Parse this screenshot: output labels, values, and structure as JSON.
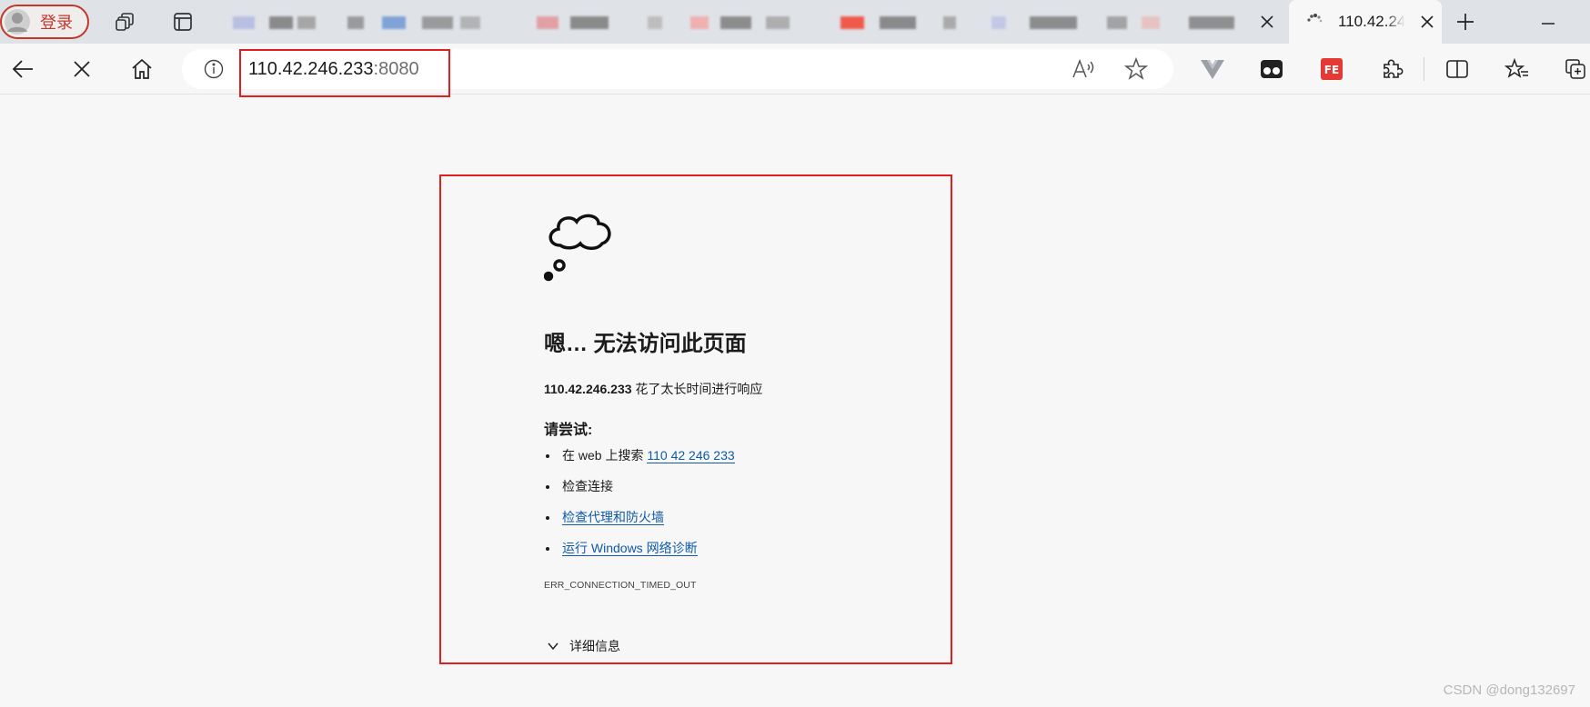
{
  "browser": {
    "profile_label": "登录",
    "active_tab": {
      "title": "110.42.246.233:8080"
    },
    "address_bar": {
      "host": "110.42.246.233",
      "port": ":8080"
    }
  },
  "error_page": {
    "title": "嗯… 无法访问此页面",
    "host": "110.42.246.233",
    "message": " 花了太长时间进行响应",
    "try_label": "请尝试:",
    "suggestions": {
      "search_prefix": "在 web 上搜索 ",
      "search_link": "110 42 246 233",
      "check_connection": "检查连接",
      "check_proxy": "检查代理和防火墙",
      "run_diagnostics": "运行 Windows 网络诊断"
    },
    "error_code": "ERR_CONNECTION_TIMED_OUT",
    "details_label": "详细信息"
  },
  "watermark": "CSDN @dong132697",
  "colors": {
    "link": "#0f5aa8",
    "highlight_box": "#e0201f",
    "profile_accent": "#c0392b"
  }
}
